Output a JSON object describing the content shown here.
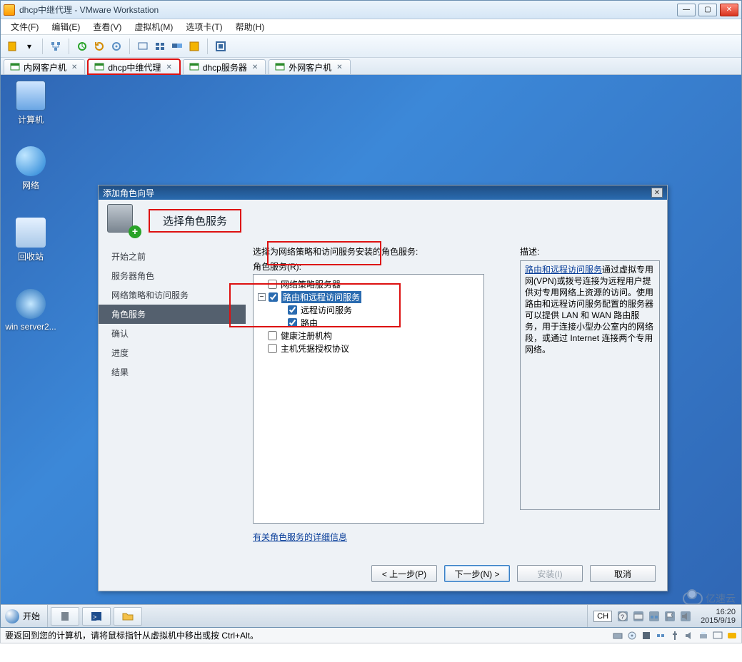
{
  "vmware": {
    "title": "dhcp中继代理 - VMware Workstation",
    "menu": [
      "文件(F)",
      "编辑(E)",
      "查看(V)",
      "虚拟机(M)",
      "选项卡(T)",
      "帮助(H)"
    ],
    "tabs": [
      {
        "label": "内网客户机"
      },
      {
        "label": "dhcp中维代理"
      },
      {
        "label": "dhcp服务器"
      },
      {
        "label": "外网客户机"
      }
    ],
    "status_hint": "要返回到您的计算机，请将鼠标指针从虚拟机中移出或按 Ctrl+Alt。"
  },
  "desktop_icons": {
    "computer": "计算机",
    "network": "网络",
    "recycle": "回收站",
    "winserver": "win server2..."
  },
  "wizard": {
    "window_title": "添加角色向导",
    "header": "选择角色服务",
    "sidebar": [
      "开始之前",
      "服务器角色",
      "网络策略和访问服务",
      "角色服务",
      "确认",
      "进度",
      "结果"
    ],
    "active_step": "角色服务",
    "prompt": "选择为网络策略和访问服务安装的角色服务:",
    "tree_label": "角色服务(R):",
    "tree": {
      "nps": {
        "label": "网络策略服务器",
        "checked": false
      },
      "rras": {
        "label": "路由和远程访问服务",
        "checked": true,
        "expanded": true
      },
      "ras": {
        "label": "远程访问服务",
        "checked": true
      },
      "routing": {
        "label": "路由",
        "checked": true
      },
      "hra": {
        "label": "健康注册机构",
        "checked": false
      },
      "hcap": {
        "label": "主机凭据授权协议",
        "checked": false
      }
    },
    "desc_title": "描述:",
    "desc_link": "路由和远程访问服务",
    "desc_text": "通过虚拟专用网(VPN)或拨号连接为远程用户提供对专用网络上资源的访问。使用路由和远程访问服务配置的服务器可以提供 LAN 和 WAN 路由服务，用于连接小型办公室内的网络段，或通过 Internet 连接两个专用网络。",
    "more_link": "有关角色服务的详细信息",
    "buttons": {
      "prev": "< 上一步(P)",
      "next": "下一步(N) >",
      "install": "安装(I)",
      "cancel": "取消"
    }
  },
  "taskbar": {
    "start": "开始",
    "lang": "CH",
    "time": "16:20",
    "date": "2015/9/19"
  },
  "watermark": "亿速云"
}
